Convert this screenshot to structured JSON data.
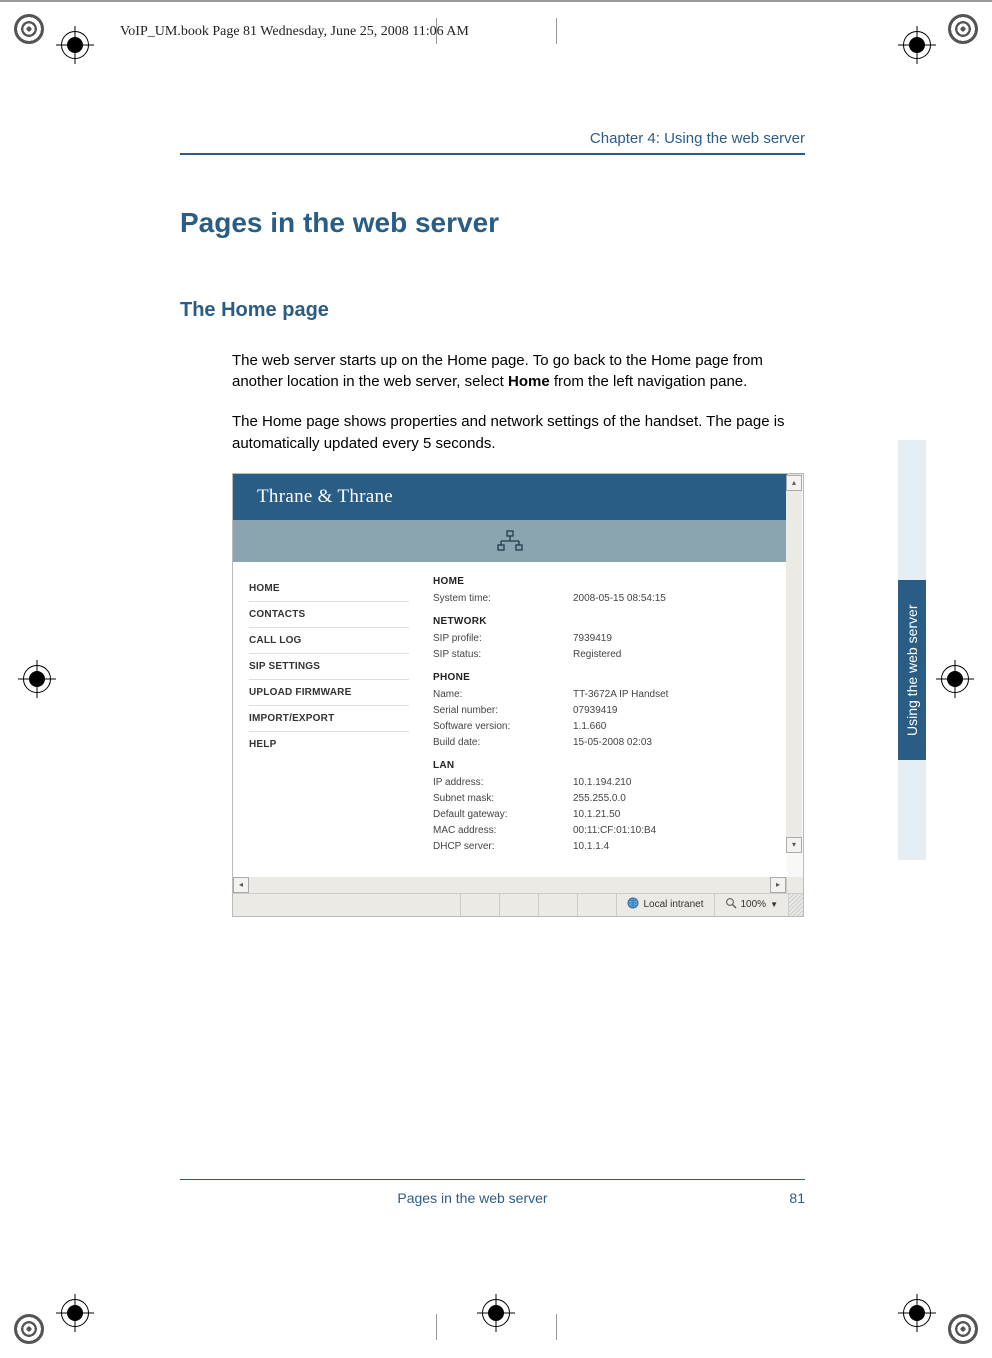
{
  "meta_header": "VoIP_UM.book  Page 81  Wednesday, June 25, 2008  11:06 AM",
  "chapter_label": "Chapter 4:  Using the web server",
  "page_title": "Pages in the web server",
  "sub_title": "The Home page",
  "paragraph1_a": "The web server starts up on the Home page. To go back to the Home page from another location in the web server, select ",
  "paragraph1_bold": "Home",
  "paragraph1_b": " from the left navigation pane.",
  "paragraph2": "The Home page shows properties and network settings of the handset. The page is automatically updated every 5 seconds.",
  "side_tab": "Using the web server",
  "footer_text": "Pages in the web server",
  "footer_page": "81",
  "screenshot": {
    "brand": "Thrane & Thrane",
    "nav": {
      "items": [
        "HOME",
        "CONTACTS",
        "CALL LOG",
        "SIP SETTINGS",
        "UPLOAD FIRMWARE",
        "IMPORT/EXPORT",
        "HELP"
      ]
    },
    "sections": [
      {
        "title": "HOME",
        "rows": [
          {
            "k": "System time:",
            "v": "2008-05-15 08:54:15"
          }
        ]
      },
      {
        "title": "NETWORK",
        "rows": [
          {
            "k": "SIP profile:",
            "v": "7939419"
          },
          {
            "k": "SIP status:",
            "v": "Registered"
          }
        ]
      },
      {
        "title": "PHONE",
        "rows": [
          {
            "k": "Name:",
            "v": "TT-3672A IP Handset"
          },
          {
            "k": "Serial number:",
            "v": "07939419"
          },
          {
            "k": "Software version:",
            "v": "1.1.660"
          },
          {
            "k": "Build date:",
            "v": "15-05-2008 02:03"
          }
        ]
      },
      {
        "title": "LAN",
        "rows": [
          {
            "k": "IP address:",
            "v": "10.1.194.210"
          },
          {
            "k": "Subnet mask:",
            "v": "255.255.0.0"
          },
          {
            "k": "Default gateway:",
            "v": "10.1.21.50"
          },
          {
            "k": "MAC address:",
            "v": "00:11:CF:01:10:B4"
          },
          {
            "k": "DHCP server:",
            "v": "10.1.1.4"
          }
        ]
      }
    ],
    "statusbar": {
      "zone": "Local intranet",
      "zoom": "100%"
    }
  }
}
